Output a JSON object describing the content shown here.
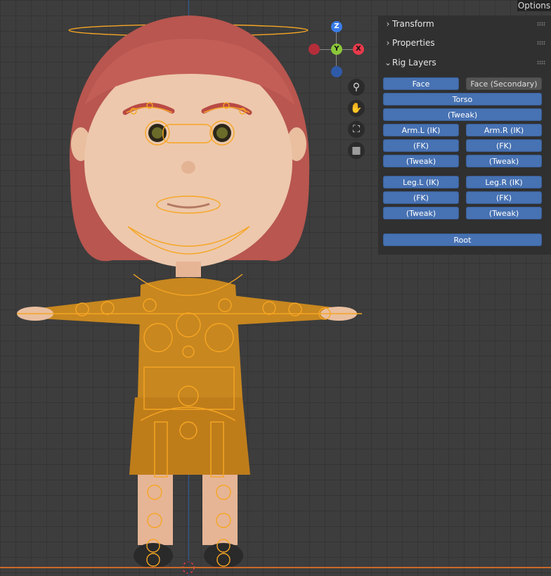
{
  "header": {
    "options_label": "Options"
  },
  "gizmo": {
    "z_label": "Z",
    "y_label": "Y",
    "x_label": "X"
  },
  "nav_icons": [
    "zoom-icon",
    "hand-pan-icon",
    "camera-icon",
    "grid-icon"
  ],
  "panel": {
    "transform_label": "Transform",
    "properties_label": "Properties",
    "rig_layers_label": "Rig Layers",
    "buttons": {
      "face": "Face",
      "face_secondary": "Face (Secondary)",
      "torso": "Torso",
      "torso_tweak": "(Tweak)",
      "arm_l_ik": "Arm.L (IK)",
      "arm_r_ik": "Arm.R (IK)",
      "arm_l_fk": "(FK)",
      "arm_r_fk": "(FK)",
      "arm_l_tweak": "(Tweak)",
      "arm_r_tweak": "(Tweak)",
      "leg_l_ik": "Leg.L (IK)",
      "leg_r_ik": "Leg.R (IK)",
      "leg_l_fk": "(FK)",
      "leg_r_fk": "(FK)",
      "leg_l_tweak": "(Tweak)",
      "leg_r_tweak": "(Tweak)",
      "root": "Root"
    },
    "face_secondary_active": false
  },
  "colors": {
    "viewport_bg": "#3d3d3d",
    "panel_bg": "#303030",
    "button_active": "#4772b3",
    "button_inactive": "#545454",
    "bone_selected": "#f6a623",
    "x_axis": "#e83a4b",
    "y_axis": "#8bc83a",
    "z_axis": "#3a7be8"
  }
}
